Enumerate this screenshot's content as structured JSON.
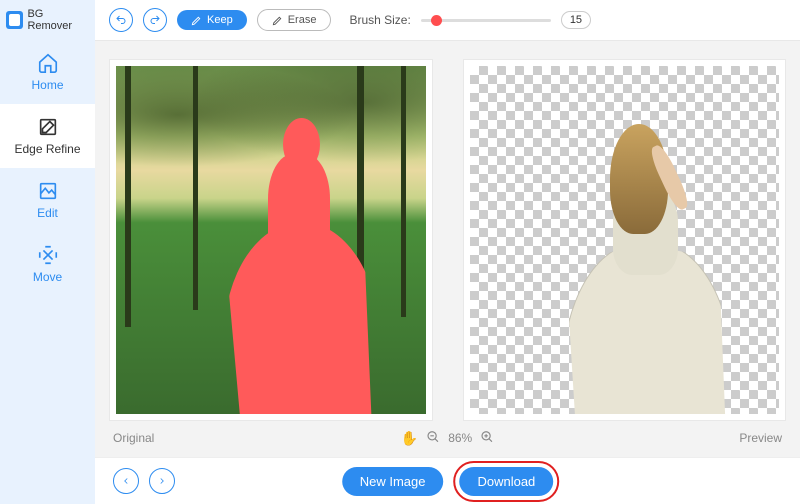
{
  "app": {
    "title": "BG Remover"
  },
  "sidebar": {
    "items": [
      {
        "label": "Home"
      },
      {
        "label": "Edge Refine"
      },
      {
        "label": "Edit"
      },
      {
        "label": "Move"
      }
    ]
  },
  "toolbar": {
    "keep_label": "Keep",
    "erase_label": "Erase",
    "brush_label": "Brush Size:",
    "brush_value": "15"
  },
  "canvas": {
    "original_label": "Original",
    "preview_label": "Preview",
    "zoom_percent": "86%"
  },
  "footer": {
    "new_image_label": "New Image",
    "download_label": "Download"
  }
}
